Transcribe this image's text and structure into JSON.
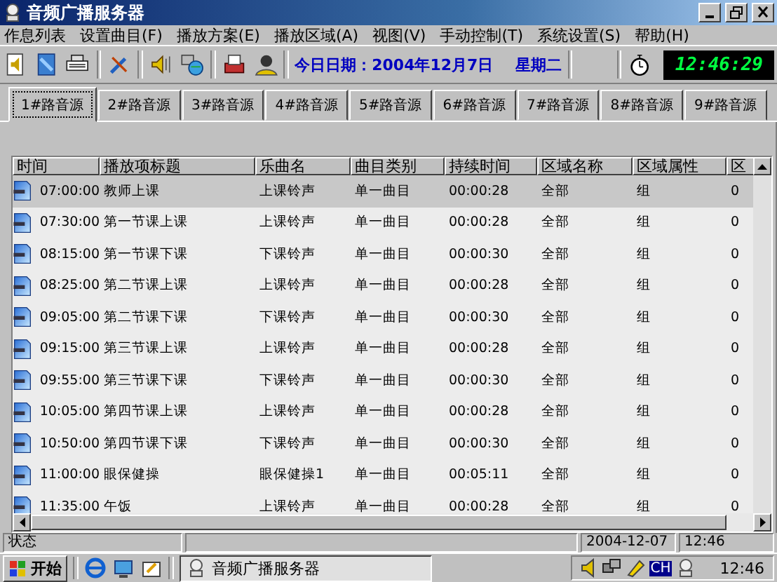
{
  "window": {
    "title": "音频广播服务器"
  },
  "menu": [
    "作息列表",
    "设置曲目(F)",
    "播放方案(E)",
    "播放区域(A)",
    "视图(V)",
    "手动控制(T)",
    "系统设置(S)",
    "帮助(H)"
  ],
  "toolbar": {
    "date": "今日日期：2004年12月7日",
    "weekday": "星期二",
    "clock": "12:46:29"
  },
  "tabs": [
    {
      "label": "1#路音源",
      "selected": true
    },
    {
      "label": "2#路音源",
      "selected": false
    },
    {
      "label": "3#路音源",
      "selected": false
    },
    {
      "label": "4#路音源",
      "selected": false
    },
    {
      "label": "5#路音源",
      "selected": false
    },
    {
      "label": "6#路音源",
      "selected": false
    },
    {
      "label": "7#路音源",
      "selected": false
    },
    {
      "label": "8#路音源",
      "selected": false
    },
    {
      "label": "9#路音源",
      "selected": false
    }
  ],
  "table": {
    "columns": [
      "时间",
      "播放项标题",
      "乐曲名",
      "曲目类别",
      "持续时间",
      "区域名称",
      "区域属性",
      "区"
    ],
    "rows": [
      {
        "selected": true,
        "cells": [
          "07:00:00",
          "教师上课",
          "上课铃声",
          "单一曲目",
          "00:00:28",
          "全部",
          "组",
          "0"
        ]
      },
      {
        "selected": false,
        "cells": [
          "07:30:00",
          "第一节课上课",
          "上课铃声",
          "单一曲目",
          "00:00:28",
          "全部",
          "组",
          "0"
        ]
      },
      {
        "selected": false,
        "cells": [
          "08:15:00",
          "第一节课下课",
          "下课铃声",
          "单一曲目",
          "00:00:30",
          "全部",
          "组",
          "0"
        ]
      },
      {
        "selected": false,
        "cells": [
          "08:25:00",
          "第二节课上课",
          "上课铃声",
          "单一曲目",
          "00:00:28",
          "全部",
          "组",
          "0"
        ]
      },
      {
        "selected": false,
        "cells": [
          "09:05:00",
          "第二节课下课",
          "下课铃声",
          "单一曲目",
          "00:00:30",
          "全部",
          "组",
          "0"
        ]
      },
      {
        "selected": false,
        "cells": [
          "09:15:00",
          "第三节课上课",
          "上课铃声",
          "单一曲目",
          "00:00:28",
          "全部",
          "组",
          "0"
        ]
      },
      {
        "selected": false,
        "cells": [
          "09:55:00",
          "第三节课下课",
          "下课铃声",
          "单一曲目",
          "00:00:30",
          "全部",
          "组",
          "0"
        ]
      },
      {
        "selected": false,
        "cells": [
          "10:05:00",
          "第四节课上课",
          "上课铃声",
          "单一曲目",
          "00:00:28",
          "全部",
          "组",
          "0"
        ]
      },
      {
        "selected": false,
        "cells": [
          "10:50:00",
          "第四节课下课",
          "下课铃声",
          "单一曲目",
          "00:00:30",
          "全部",
          "组",
          "0"
        ]
      },
      {
        "selected": false,
        "cells": [
          "11:00:00",
          "眼保健操",
          "眼保健操1",
          "单一曲目",
          "00:05:11",
          "全部",
          "组",
          "0"
        ]
      },
      {
        "selected": false,
        "cells": [
          "11:35:00",
          "午饭",
          "上课铃声",
          "单一曲目",
          "00:00:28",
          "全部",
          "组",
          "0"
        ]
      }
    ]
  },
  "status_bar": {
    "status": "状态",
    "date": "2004-12-07",
    "time": "12:46"
  },
  "taskbar": {
    "start": "开始",
    "tasks": [
      {
        "label": "音频广播服务器"
      }
    ],
    "input_method": "CH",
    "clock": "12:46"
  }
}
